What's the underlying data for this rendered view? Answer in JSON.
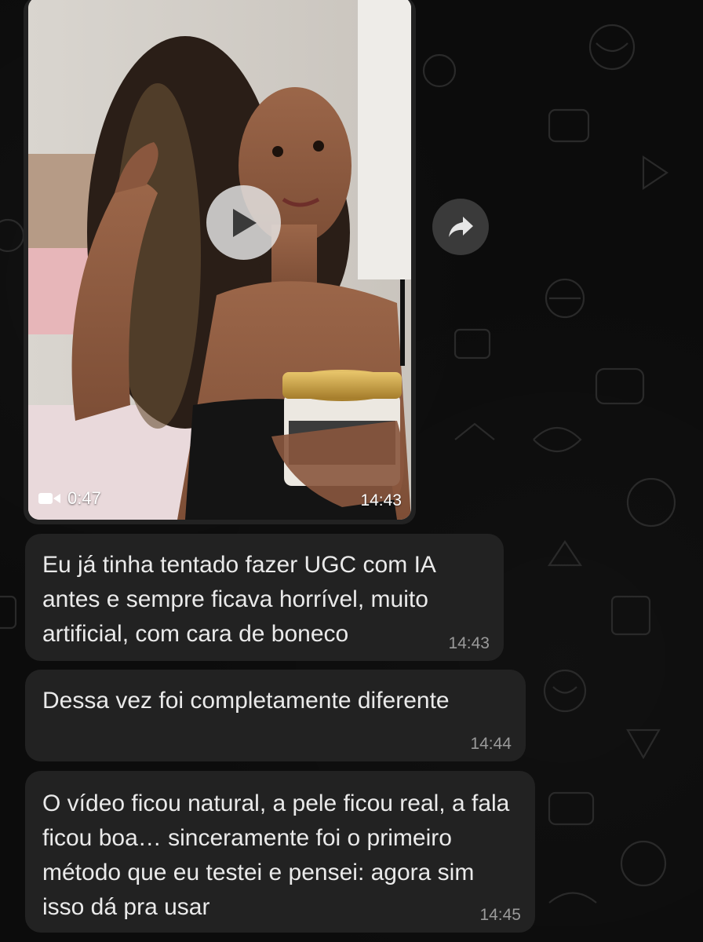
{
  "chat": {
    "video_message": {
      "duration": "0:47",
      "time": "14:43",
      "icons": {
        "play": "play-icon",
        "forward": "forward-icon",
        "video": "video-camera-icon"
      }
    },
    "messages": [
      {
        "text": "Eu já tinha tentado fazer UGC com IA antes e sempre ficava horrível, muito artificial, com cara de boneco",
        "time": "14:43"
      },
      {
        "text": "Dessa vez foi completamente diferente",
        "time": "14:44"
      },
      {
        "text": "O vídeo ficou natural, a pele ficou real, a fala ficou boa… sinceramente foi o primeiro método que eu testei e pensei: agora sim isso dá pra usar",
        "time": "14:45"
      }
    ]
  },
  "colors": {
    "background": "#0c0c0c",
    "bubble": "#222222",
    "text": "#eaeaea",
    "timestamp": "#9a9a9a"
  }
}
